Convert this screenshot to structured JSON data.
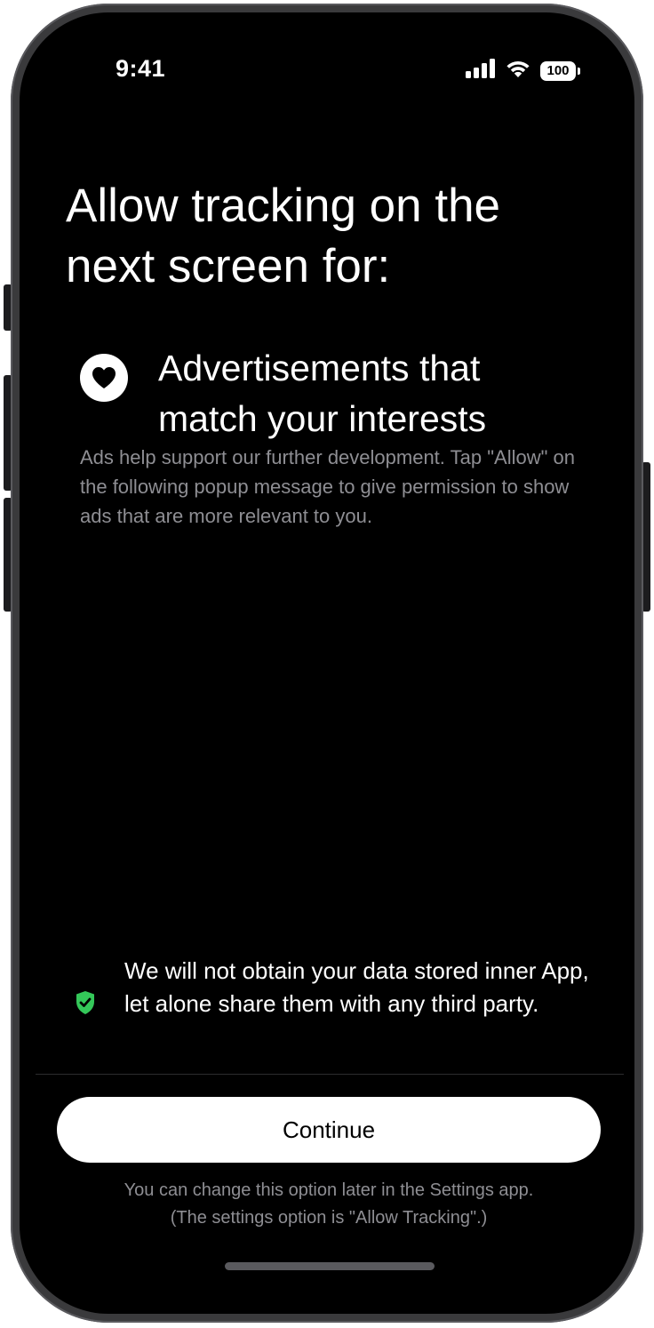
{
  "status_bar": {
    "time": "9:41",
    "battery": "100",
    "icons": [
      "signal-icon",
      "wifi-icon",
      "battery-icon"
    ]
  },
  "headline": {
    "line1": "Allow tracking on the",
    "line2": "next screen for:"
  },
  "feature": {
    "icon": "heart-icon",
    "title_line1": "Advertisements that",
    "title_line2": "match your interests",
    "description": "Ads help support our further development. Tap \"Allow\" on the following popup message to give permission to show ads that are more relevant to you."
  },
  "privacy": {
    "icon": "shield-check-icon",
    "text": "We will not obtain your data stored inner App, let alone share them with any third party."
  },
  "continue_label": "Continue",
  "footnote": {
    "line1": "You can change this option later in the Settings app.",
    "line2": "(The settings option is \"Allow Tracking\".)"
  },
  "colors": {
    "background": "#000000",
    "primary_text": "#ffffff",
    "secondary_text": "#8e8e93",
    "accent_green": "#34c759",
    "button_bg": "#ffffff",
    "button_text": "#000000"
  }
}
